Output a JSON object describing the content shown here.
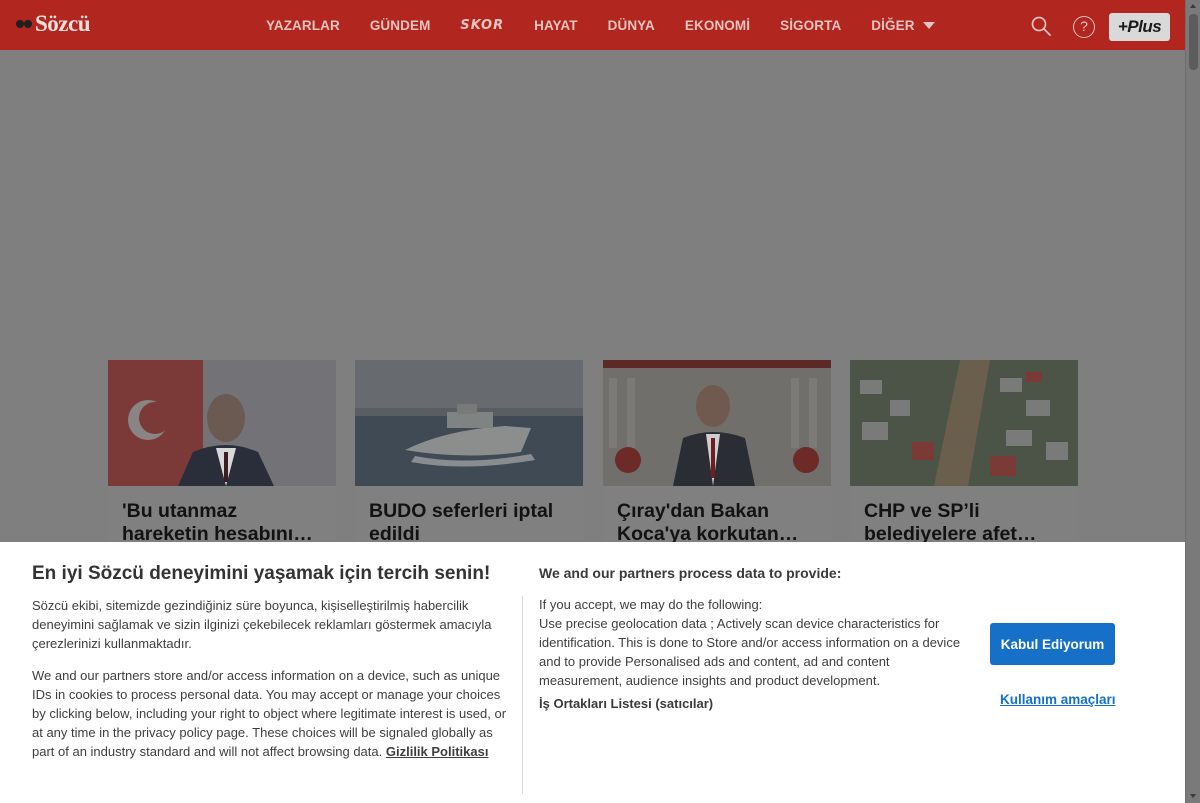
{
  "header": {
    "logo_text": "Sözcü",
    "nav": [
      {
        "label": "YAZARLAR"
      },
      {
        "label": "GÜNDEM"
      },
      {
        "label": "SKOR"
      },
      {
        "label": "HAYAT"
      },
      {
        "label": "DÜNYA"
      },
      {
        "label": "EKONOMİ"
      },
      {
        "label": "SİGORTA"
      },
      {
        "label": "DİĞER"
      }
    ],
    "plus_label": "+Plus",
    "help_glyph": "?"
  },
  "cards": [
    {
      "title": "'Bu utanmaz hareketin hesabını…",
      "image": "portrait-turkish-flag"
    },
    {
      "title": "BUDO seferleri iptal edildi",
      "image": "ferry-on-sea"
    },
    {
      "title": "Çıray'dan Bakan Koca'ya korkutan…",
      "image": "man-at-podium"
    },
    {
      "title": "CHP ve SP’li belediyelere afet…",
      "image": "flooded-town-aerial"
    }
  ],
  "consent": {
    "title": "En iyi Sözcü deneyimini yaşamak için tercih senin!",
    "paragraph1": "Sözcü ekibi, sitemizde gezindiğiniz süre boyunca, kişiselleştirilmiş habercilik deneyimini sağlamak ve sizin ilginizi çekebilecek reklamları göstermek amacıyla çerezlerinizi kullanmaktadır.",
    "paragraph2": "We and our partners store and/or access information on a device, such as unique IDs in cookies to process personal data. You may accept or manage your choices by clicking below, including your right to object where legitimate interest is used, or at any time in the privacy policy page. These choices will be signaled globally as part of an industry standard and will not affect browsing data.",
    "privacy_link": "Gizlilik Politikası",
    "right_title": "We and our partners process data to provide:",
    "right_line1": "If you accept, we may do the following:",
    "right_text": "Use precise geolocation data ; Actively scan device characteristics for identification. This is done to Store and/or access information on a device and to provide Personalised ads and content, ad and content measurement, audience insights and product development.",
    "vendors_link": "İş Ortakları Listesi (satıcılar)",
    "accept_label": "Kabul Ediyorum",
    "purposes_label": "Kullanım amaçları"
  },
  "colors": {
    "brand_red": "#b1261f",
    "accept_blue": "#1670c8",
    "overlay": "#7f7f7f"
  }
}
